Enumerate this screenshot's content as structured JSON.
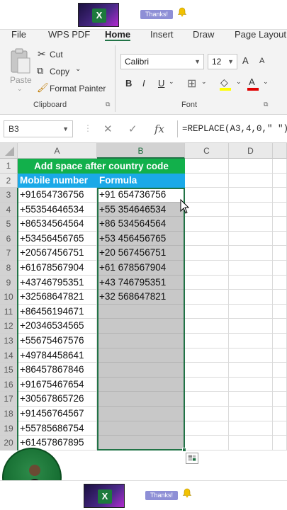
{
  "banner": {
    "thanks_label": "Thanks!",
    "logo_letter": "X"
  },
  "ribbon": {
    "tabs": [
      "File",
      "WPS PDF",
      "Home",
      "Insert",
      "Draw",
      "Page Layout"
    ],
    "active_tab": "Home",
    "clipboard": {
      "paste_label": "Paste",
      "cut_label": "Cut",
      "copy_label": "Copy",
      "format_painter_label": "Format Painter",
      "group_label": "Clipboard"
    },
    "font": {
      "font_name": "Calibri",
      "font_size": "12",
      "grow_label": "A",
      "shrink_label": "A",
      "bold_label": "B",
      "italic_label": "I",
      "underline_label": "U",
      "font_color_label": "A",
      "group_label": "Font"
    }
  },
  "formula_bar": {
    "name_box": "B3",
    "cancel_icon": "✕",
    "enter_icon": "✓",
    "fx_label": "fx",
    "formula": "=REPLACE(A3,4,0,\" \")"
  },
  "sheet": {
    "columns": [
      "A",
      "B",
      "C",
      "D"
    ],
    "selected_column": "B",
    "title": "Add space after country code",
    "header_a": "Mobile number",
    "header_b": "Formula",
    "rows": [
      {
        "n": "1"
      },
      {
        "n": "2"
      },
      {
        "n": "3",
        "a": "+91654736756",
        "b": "+91 654736756"
      },
      {
        "n": "4",
        "a": "+55354646534",
        "b": "+55 354646534"
      },
      {
        "n": "5",
        "a": "+86534564564",
        "b": "+86 534564564"
      },
      {
        "n": "6",
        "a": "+53456456765",
        "b": "+53 456456765"
      },
      {
        "n": "7",
        "a": "+20567456751",
        "b": "+20 567456751"
      },
      {
        "n": "8",
        "a": "+61678567904",
        "b": "+61 678567904"
      },
      {
        "n": "9",
        "a": "+43746795351",
        "b": "+43 746795351"
      },
      {
        "n": "10",
        "a": "+32568647821",
        "b": "+32 568647821"
      },
      {
        "n": "11",
        "a": "+86456194671",
        "b": ""
      },
      {
        "n": "12",
        "a": "+20346534565",
        "b": ""
      },
      {
        "n": "13",
        "a": "+55675467576",
        "b": ""
      },
      {
        "n": "14",
        "a": "+49784458641",
        "b": ""
      },
      {
        "n": "15",
        "a": "+86457867846",
        "b": ""
      },
      {
        "n": "16",
        "a": "+91675467654",
        "b": ""
      },
      {
        "n": "17",
        "a": "+30567865726",
        "b": ""
      },
      {
        "n": "18",
        "a": "+91456764567",
        "b": ""
      },
      {
        "n": "19",
        "a": "+55785686754",
        "b": ""
      },
      {
        "n": "20",
        "a": "+61457867895",
        "b": ""
      }
    ]
  },
  "colors": {
    "title_bg": "#12b04b",
    "header_bg": "#1aa9e8",
    "selection": "#217346",
    "selected_fill": "#c8c8c8"
  }
}
